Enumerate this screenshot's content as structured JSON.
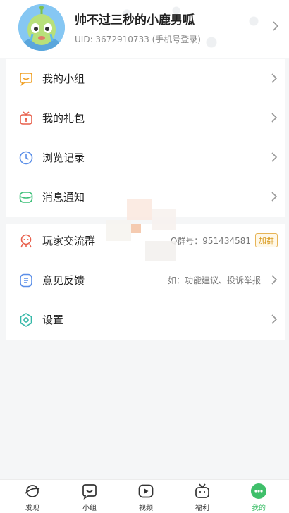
{
  "profile": {
    "username": "帅不过三秒的小鹿男呱",
    "uid_text": "UID: 3672910733 (手机号登录)"
  },
  "menu": {
    "items": [
      {
        "label": "我的小组",
        "icon": "group-chat-icon"
      },
      {
        "label": "我的礼包",
        "icon": "gift-icon"
      },
      {
        "label": "浏览记录",
        "icon": "clock-icon"
      },
      {
        "label": "消息通知",
        "icon": "message-icon"
      },
      {
        "label": "玩家交流群",
        "icon": "player-group-icon",
        "right_text": "Q群号：951434581",
        "badge": "加群"
      },
      {
        "label": "意见反馈",
        "icon": "feedback-icon",
        "right_text": "如：功能建议、投诉举报"
      },
      {
        "label": "设置",
        "icon": "settings-icon"
      }
    ]
  },
  "tabbar": {
    "tabs": [
      {
        "label": "发现",
        "icon": "planet-icon"
      },
      {
        "label": "小组",
        "icon": "smile-chat-icon"
      },
      {
        "label": "视频",
        "icon": "play-icon"
      },
      {
        "label": "福利",
        "icon": "gift-box-icon"
      },
      {
        "label": "我的",
        "icon": "me-icon",
        "active": true
      }
    ]
  },
  "colors": {
    "accent": "#3fbf6a",
    "orange": "#f0a229",
    "red": "#e8604c",
    "blue": "#5a8ee8",
    "green": "#3fc07a",
    "teal": "#35b8a8",
    "badge": "#d99b1f"
  }
}
